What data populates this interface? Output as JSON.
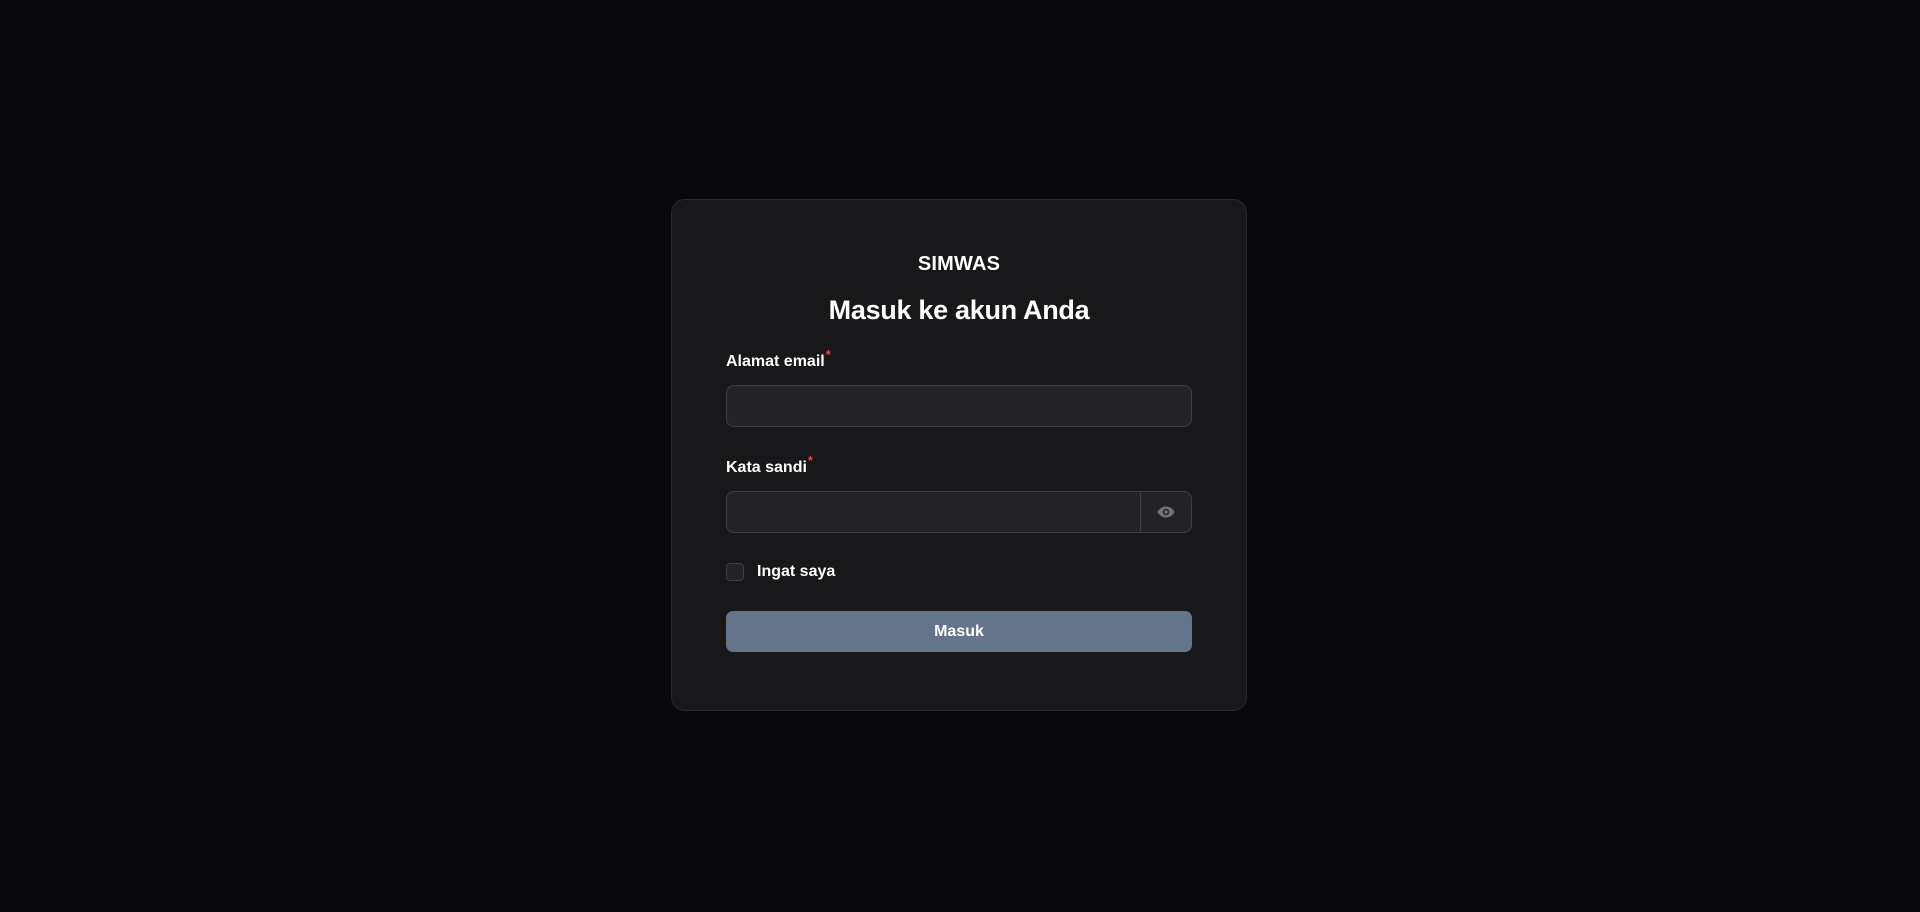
{
  "login": {
    "brand": "SIMWAS",
    "heading": "Masuk ke akun Anda",
    "email_label": "Alamat email",
    "email_required": "*",
    "email_value": "",
    "password_label": "Kata sandi",
    "password_required": "*",
    "password_value": "",
    "password_toggle_icon": "eye-icon",
    "remember_label": "Ingat saya",
    "remember_checked": false,
    "submit_label": "Masuk"
  },
  "colors": {
    "background": "#09090b",
    "card": "#18181b",
    "input": "#232326",
    "required": "#ef4444",
    "button": "#64748b"
  }
}
